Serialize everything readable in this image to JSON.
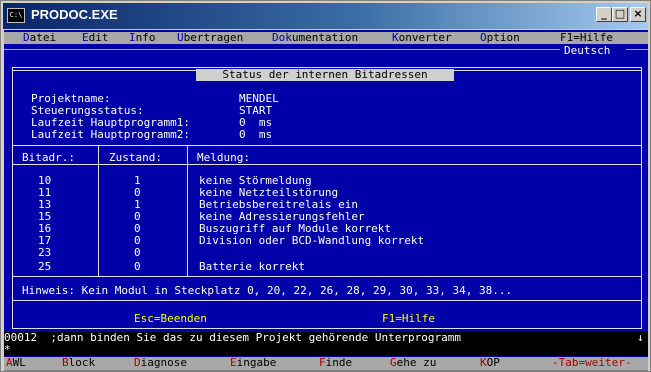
{
  "window": {
    "title": "PRODOC.EXE",
    "icon_text": "C:\\",
    "controls": [
      "_",
      "□",
      "×"
    ]
  },
  "menu": {
    "items": [
      {
        "hot": "D",
        "rest": "atei"
      },
      {
        "hot": "E",
        "rest": "dit"
      },
      {
        "hot": "I",
        "rest": "nfo"
      },
      {
        "hot": "Ü",
        "rest": "bertragen"
      },
      {
        "hot": "Dok",
        "rest": "umentation"
      },
      {
        "hot": "K",
        "rest": "onverter"
      },
      {
        "hot": "O",
        "rest": "ption"
      }
    ],
    "help": "F1=Hilfe",
    "language": "Deutsch"
  },
  "dialog": {
    "title": " Status der internen Bitadressen ",
    "fields": [
      {
        "label": "Projektname:",
        "value": "MENDEL"
      },
      {
        "label": "Steuerungsstatus:",
        "value": "START"
      },
      {
        "label": "Laufzeit Hauptprogramm1:",
        "value": "0  ms"
      },
      {
        "label": "Laufzeit Hauptprogramm2:",
        "value": "0  ms"
      }
    ],
    "columns": [
      "Bitadr.:",
      "Zustand:",
      "Meldung:"
    ],
    "rows": [
      {
        "addr": "10",
        "state": "1",
        "msg": "keine Störmeldung"
      },
      {
        "addr": "11",
        "state": "0",
        "msg": "keine Netzteilstörung"
      },
      {
        "addr": "13",
        "state": "1",
        "msg": "Betriebsbereitrelais ein"
      },
      {
        "addr": "15",
        "state": "0",
        "msg": "keine Adressierungsfehler"
      },
      {
        "addr": "16",
        "state": "0",
        "msg": "Buszugriff auf Module korrekt"
      },
      {
        "addr": "17",
        "state": "0",
        "msg": "Division oder BCD-Wandlung korrekt"
      },
      {
        "addr": "23",
        "state": "0",
        "msg": ""
      },
      {
        "addr": "25",
        "state": "0",
        "msg": "Batterie korrekt"
      }
    ],
    "hint": "Hinweis: Kein Modul in Steckplatz 0, 20, 22, 26, 28, 29, 30, 33, 34, 38...",
    "esc": "Esc=Beenden",
    "f1": "F1=Hilfe"
  },
  "statusline": "00012  ;dann binden Sie das zu diesem Projekt gehörende Unterprogramm",
  "cursor_line": "*",
  "fkeys": [
    {
      "hot": "A",
      "rest": "WL"
    },
    {
      "hot": "B",
      "rest": "lock"
    },
    {
      "hot": "D",
      "rest": "iagnose"
    },
    {
      "hot": "E",
      "rest": "ingabe"
    },
    {
      "hot": "F",
      "rest": "inde"
    },
    {
      "hot": "G",
      "rest": "ehe zu"
    },
    {
      "hot": "K",
      "rest": "OP"
    }
  ],
  "fkey_tab": "-Tab=weiter-",
  "colors": {
    "console_bg": "#0000a8",
    "text": "#ffffff",
    "highlight": "#ffff00",
    "menu_bg": "#a8a8a8",
    "hotkey": "#a80000"
  }
}
